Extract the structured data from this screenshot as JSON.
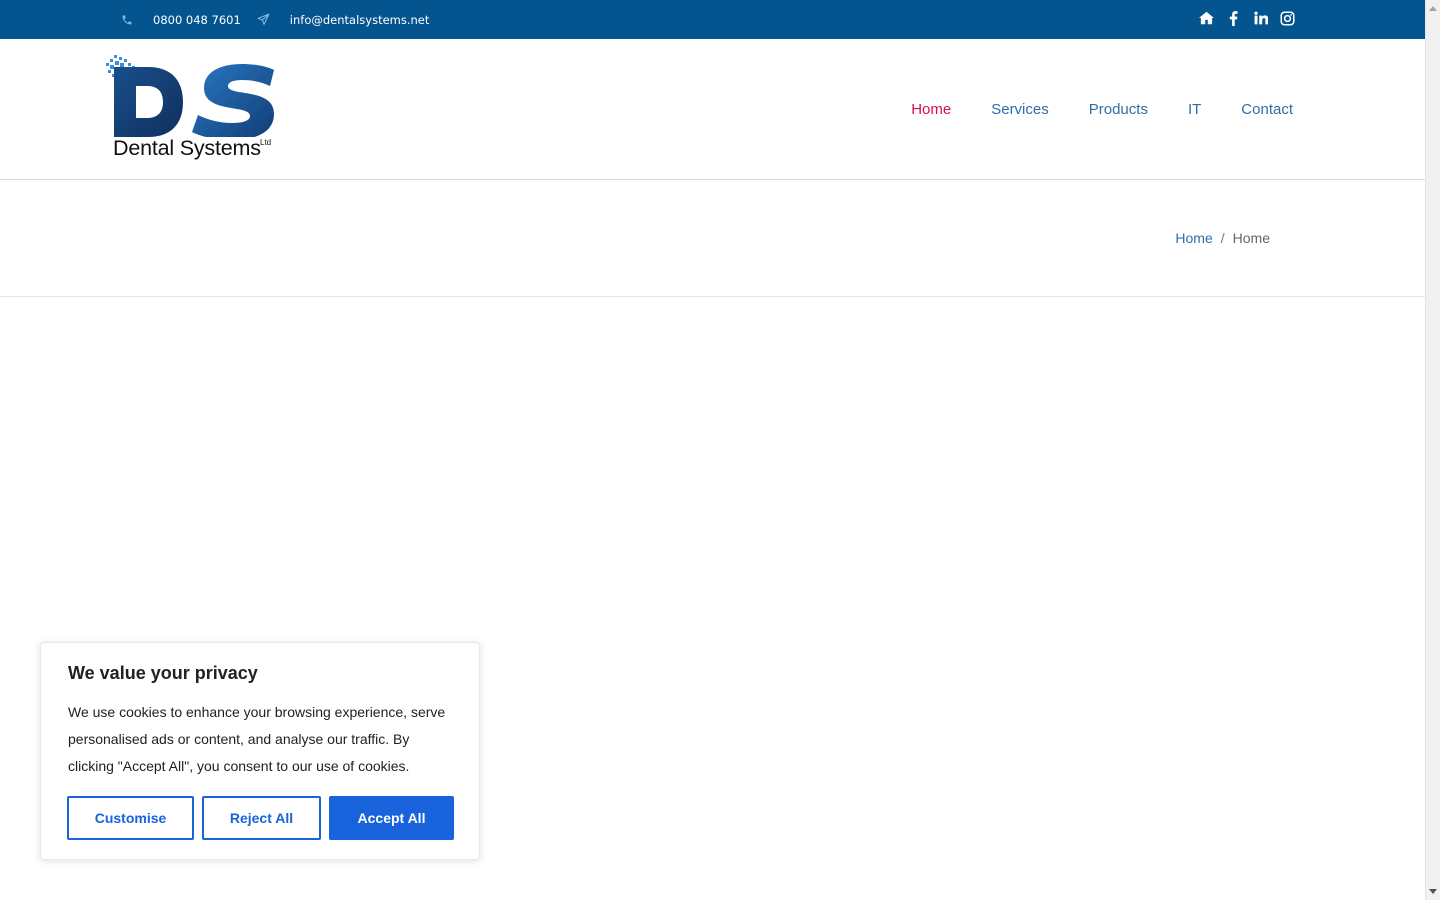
{
  "topbar": {
    "phone": "0800 048 7601",
    "email": "info@dentalsystems.net",
    "phone_icon": "phone-icon",
    "email_icon": "paper-plane-icon",
    "social_icons": [
      "home-icon",
      "facebook-icon",
      "linkedin-icon",
      "instagram-icon"
    ]
  },
  "brand": {
    "logo_letters": "DS",
    "logo_wordmark": "Dental Systems",
    "logo_suffix": "Ltd"
  },
  "nav": {
    "items": [
      "Home",
      "Services",
      "Products",
      "IT",
      "Contact"
    ],
    "active": "Home"
  },
  "breadcrumb": {
    "link": "Home",
    "separator": "/",
    "current": "Home"
  },
  "cookie": {
    "title": "We value your privacy",
    "body": "We use cookies to enhance your browsing experience, serve personalised ads or content, and analyse our traffic. By clicking \"Accept All\", you consent to our use of cookies.",
    "buttons": {
      "customise": "Customise",
      "reject": "Reject All",
      "accept": "Accept All"
    }
  },
  "colors": {
    "topbar_bg": "#045490",
    "nav_link": "#2f6fa8",
    "nav_active": "#d4114b",
    "cookie_primary": "#1863dc"
  }
}
